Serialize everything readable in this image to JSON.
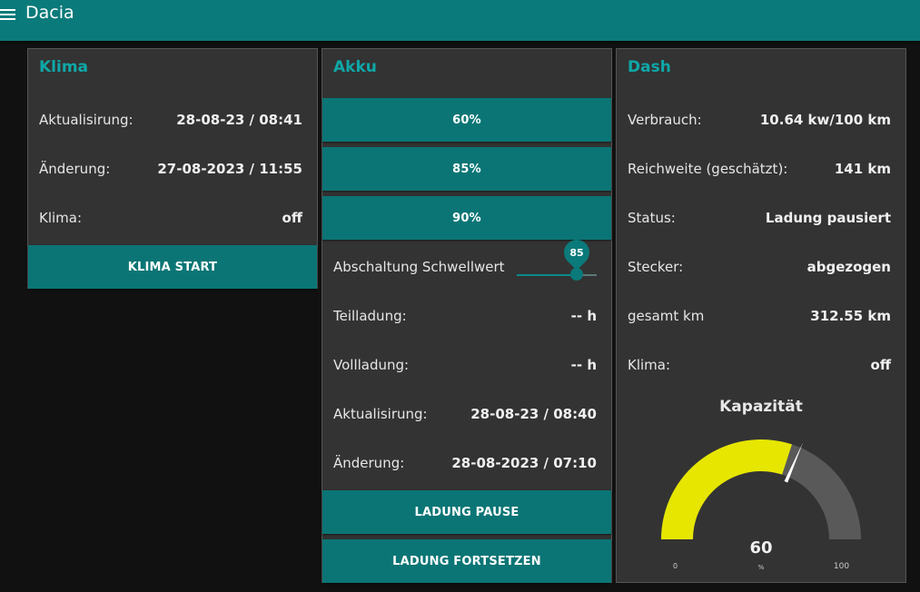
{
  "app": {
    "title": "Dacia"
  },
  "klima": {
    "title": "Klima",
    "rows": [
      {
        "label": "Aktualisirung:",
        "value": "28-08-23 / 08:41"
      },
      {
        "label": "Änderung:",
        "value": "27-08-2023 / 11:55"
      },
      {
        "label": "Klima:",
        "value": "off"
      }
    ],
    "start_button": "KLIMA START"
  },
  "akku": {
    "title": "Akku",
    "preset_buttons": [
      "60%",
      "85%",
      "90%"
    ],
    "slider": {
      "label": "Abschaltung Schwellwert",
      "value": "85",
      "fraction": 0.75
    },
    "rows": [
      {
        "label": "Teilladung:",
        "value": "-- h"
      },
      {
        "label": "Vollladung:",
        "value": "-- h"
      },
      {
        "label": "Aktualisirung:",
        "value": "28-08-23 / 08:40"
      },
      {
        "label": "Änderung:",
        "value": "28-08-2023 / 07:10"
      }
    ],
    "pause_button": "LADUNG PAUSE",
    "resume_button": "LADUNG FORTSETZEN"
  },
  "dash": {
    "title": "Dash",
    "rows": [
      {
        "label": "Verbrauch:",
        "value": "10.64 kw/100 km"
      },
      {
        "label": "Reichweite (geschätzt):",
        "value": "141 km"
      },
      {
        "label": "Status:",
        "value": "Ladung pausiert"
      },
      {
        "label": "Stecker:",
        "value": "abgezogen"
      },
      {
        "label": "gesamt km",
        "value": "312.55 km"
      },
      {
        "label": "Klima:",
        "value": "off"
      }
    ],
    "gauge": {
      "title": "Kapazität",
      "value": 60,
      "value_text": "60",
      "unit": "%",
      "min": 0,
      "max": 100,
      "min_label": "0",
      "max_label": "100",
      "needle_value": 63,
      "fill_color": "#e6e600",
      "track_color": "#595959",
      "needle_color": "#ffffff"
    }
  },
  "colors": {
    "accent": "#0b7a7a",
    "title_accent": "#0fa8a8",
    "panel_bg": "#333333",
    "page_bg": "#111111"
  }
}
